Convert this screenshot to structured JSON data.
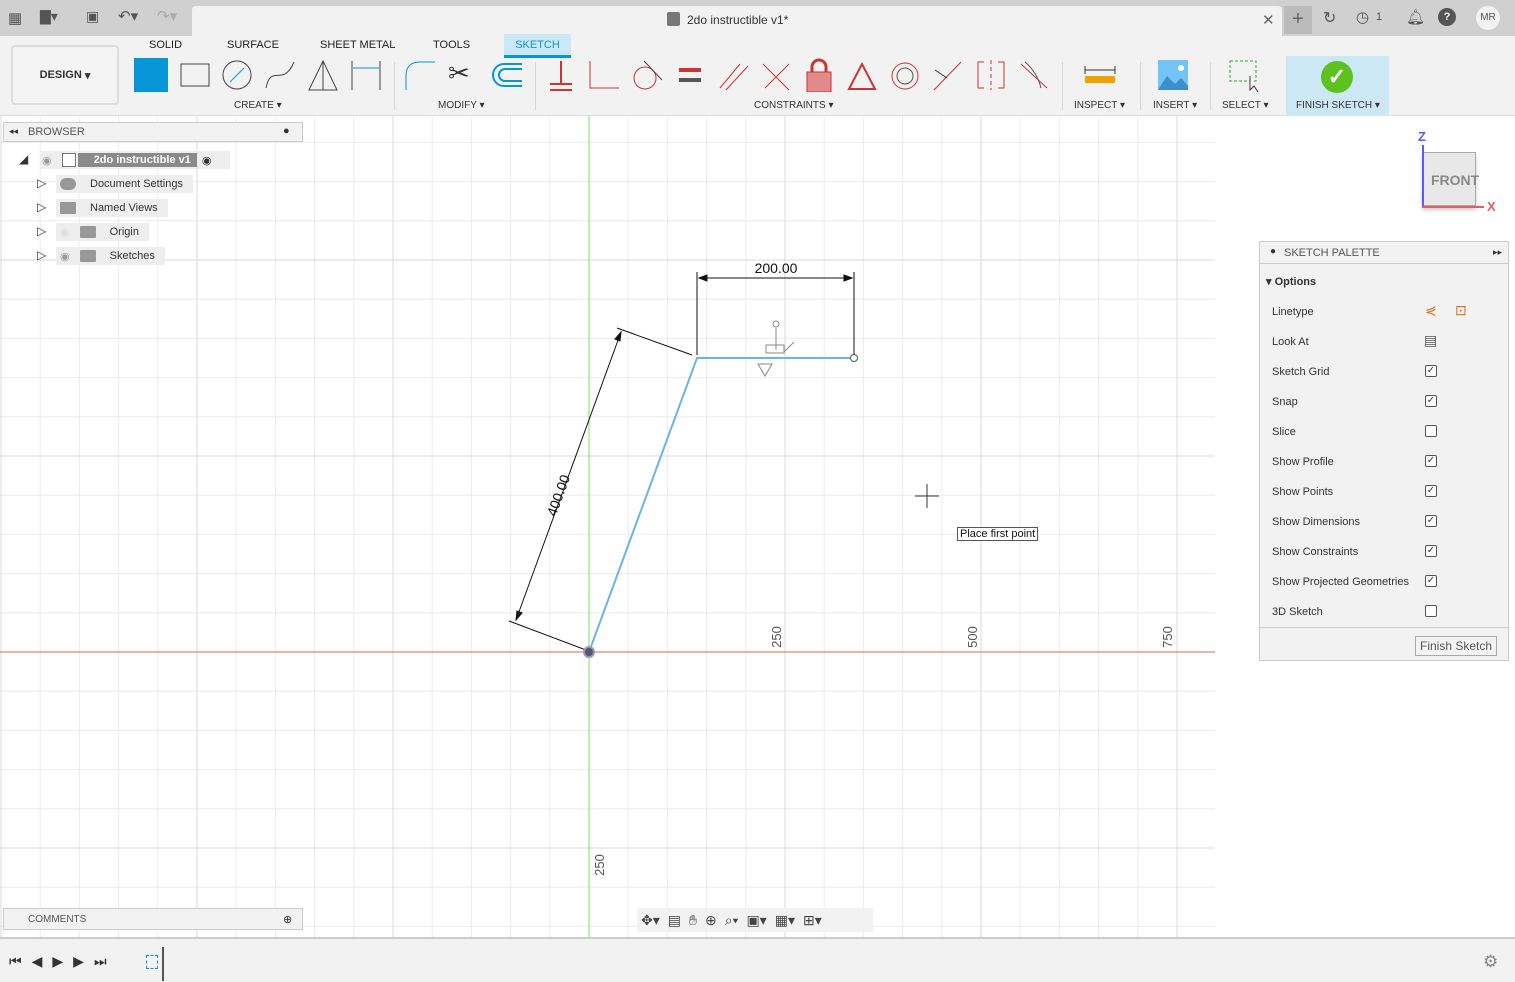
{
  "title": "2do instructible v1*",
  "user_initials": "MR",
  "job_count": "1",
  "workspace": "DESIGN",
  "tabs": [
    "SOLID",
    "SURFACE",
    "SHEET METAL",
    "TOOLS",
    "SKETCH"
  ],
  "active_tab": "SKETCH",
  "groups": {
    "create": "CREATE",
    "modify": "MODIFY",
    "constraints": "CONSTRAINTS",
    "inspect": "INSPECT",
    "insert": "INSERT",
    "select": "SELECT",
    "finish": "FINISH SKETCH"
  },
  "browser": {
    "title": "BROWSER",
    "root": "2do instructible v1",
    "items": [
      "Document Settings",
      "Named Views",
      "Origin",
      "Sketches"
    ]
  },
  "comments": "COMMENTS",
  "viewcube": {
    "face": "FRONT",
    "z": "Z",
    "x": "X"
  },
  "canvas": {
    "dim_horizontal": "200.00",
    "dim_aligned": "400.00",
    "tooltip": "Place first point",
    "ruler_x": [
      "250",
      "500",
      "750"
    ],
    "ruler_y": "250"
  },
  "palette": {
    "title": "SKETCH PALETTE",
    "section": "Options",
    "rows": [
      {
        "label": "Linetype"
      },
      {
        "label": "Look At"
      },
      {
        "label": "Sketch Grid",
        "checked": true
      },
      {
        "label": "Snap",
        "checked": true
      },
      {
        "label": "Slice",
        "checked": false
      },
      {
        "label": "Show Profile",
        "checked": true
      },
      {
        "label": "Show Points",
        "checked": true
      },
      {
        "label": "Show Dimensions",
        "checked": true
      },
      {
        "label": "Show Constraints",
        "checked": true
      },
      {
        "label": "Show Projected Geometries",
        "checked": true
      },
      {
        "label": "3D Sketch",
        "checked": false
      }
    ],
    "finish_button": "Finish Sketch"
  },
  "colors": {
    "accent": "#0696d7",
    "x_axis": "#e06060",
    "z_axis": "#5a5aff",
    "sketch_line": "#6ab4e8",
    "finish": "#5dc21e"
  }
}
